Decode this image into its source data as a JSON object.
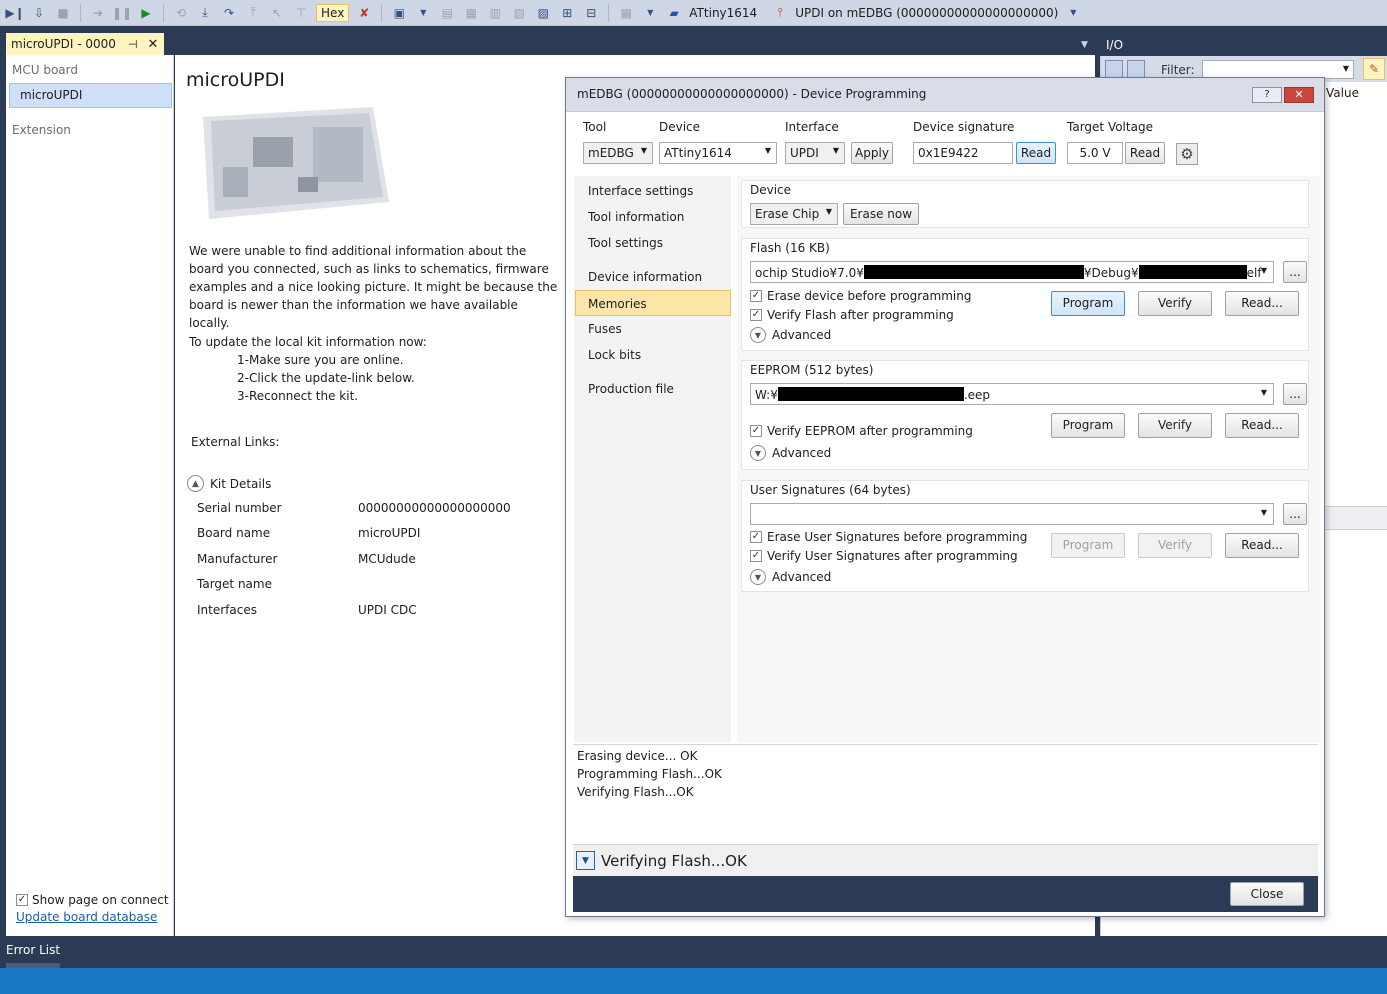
{
  "toolbar": {
    "hex_label": "Hex",
    "device": "ATtiny1614",
    "tool_conn": "UPDI on mEDBG (00000000000000000000)"
  },
  "doc_tab": {
    "title": "microUPDI - 0000",
    "pin": "⊣",
    "close": "✕"
  },
  "io_panel": {
    "title": "I/O",
    "filter_label": "Filter:",
    "value_col": "Value"
  },
  "left_panel": {
    "header": "MCU board",
    "item": "microUPDI",
    "extension": "Extension",
    "show_page": "Show page on connect",
    "update_link": "Update board database"
  },
  "main": {
    "title": "microUPDI",
    "desc": "We were unable to find additional information about the board you connected, such as links to schematics, firmware examples and a nice looking picture. It might be because the board is newer than the information we have available locally.",
    "update_intro": "To update the local kit information now:",
    "steps": [
      "1-Make sure you are online.",
      "2-Click the update-link below.",
      "3-Reconnect the kit."
    ],
    "external_links": "External Links:",
    "kit_details": "Kit Details",
    "kit": [
      {
        "label": "Serial number",
        "value": "00000000000000000000"
      },
      {
        "label": "Board name",
        "value": "microUPDI"
      },
      {
        "label": "Manufacturer",
        "value": "MCUdude"
      },
      {
        "label": "Target name",
        "value": ""
      },
      {
        "label": "Interfaces",
        "value": "UPDI CDC"
      }
    ]
  },
  "dialog": {
    "title": "mEDBG (00000000000000000000) - Device Programming",
    "help": "?",
    "close_x": "✕",
    "tool_label": "Tool",
    "tool_value": "mEDBG",
    "device_label": "Device",
    "device_value": "ATtiny1614",
    "interface_label": "Interface",
    "interface_value": "UPDI",
    "apply": "Apply",
    "sig_label": "Device signature",
    "sig_value": "0x1E9422",
    "read": "Read",
    "volt_label": "Target Voltage",
    "volt_value": "5.0 V",
    "nav": [
      "Interface settings",
      "Tool information",
      "Tool settings",
      "Device information",
      "Memories",
      "Fuses",
      "Lock bits",
      "Production file"
    ],
    "device_group": {
      "title": "Device",
      "erase_mode": "Erase Chip",
      "erase_now": "Erase now"
    },
    "flash": {
      "title": "Flash (16 KB)",
      "path_prefix": "ochip Studio¥7.0¥",
      "path_mid": "¥Debug¥",
      "path_suffix": "elf",
      "browse": "...",
      "erase_check": "Erase device before programming",
      "verify_check": "Verify Flash after programming",
      "advanced": "Advanced",
      "program": "Program",
      "verify": "Verify",
      "read": "Read..."
    },
    "eeprom": {
      "title": "EEPROM (512 bytes)",
      "path_prefix": "W:¥",
      "path_suffix": ".eep",
      "browse": "...",
      "verify_check": "Verify EEPROM after programming",
      "advanced": "Advanced",
      "program": "Program",
      "verify": "Verify",
      "read": "Read..."
    },
    "usersig": {
      "title": "User Signatures (64 bytes)",
      "browse": "...",
      "erase_check": "Erase User Signatures before programming",
      "verify_check": "Verify User Signatures after programming",
      "advanced": "Advanced",
      "program": "Program",
      "verify": "Verify",
      "read": "Read..."
    },
    "log": [
      "Erasing device... OK",
      "Programming Flash...OK",
      "Verifying Flash...OK"
    ],
    "status": "Verifying Flash...OK",
    "close_btn": "Close"
  },
  "bottom": {
    "error_list": "Error List"
  }
}
